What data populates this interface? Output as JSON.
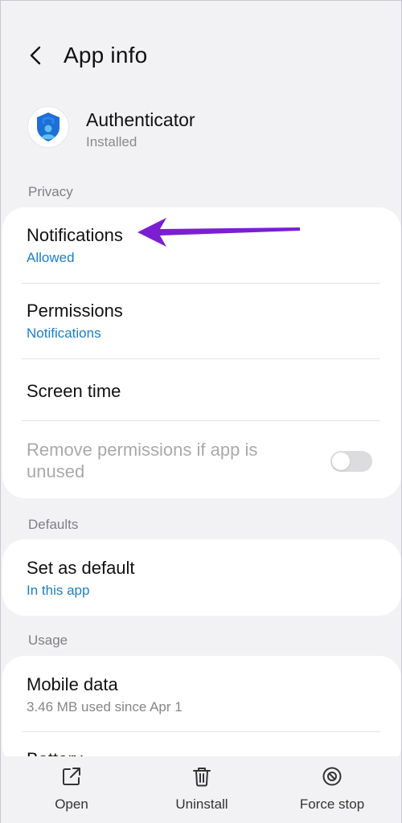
{
  "header": {
    "title": "App info",
    "back_icon": "chevron-left-icon"
  },
  "app": {
    "name": "Authenticator",
    "status": "Installed",
    "icon": "authenticator-lock-icon"
  },
  "privacy": {
    "section_label": "Privacy",
    "items": [
      {
        "title": "Notifications",
        "subtitle": "Allowed"
      },
      {
        "title": "Permissions",
        "subtitle": "Notifications"
      },
      {
        "title": "Screen time"
      },
      {
        "title": "Remove permissions if app is unused",
        "toggle_on": false
      }
    ]
  },
  "defaults": {
    "section_label": "Defaults",
    "items": [
      {
        "title": "Set as default",
        "subtitle": "In this app"
      }
    ]
  },
  "usage": {
    "section_label": "Usage",
    "items": [
      {
        "title": "Mobile data",
        "subtitle": "3.46 MB used since Apr 1"
      },
      {
        "title": "Battery"
      }
    ]
  },
  "bottom_bar": {
    "open_label": "Open",
    "uninstall_label": "Uninstall",
    "force_stop_label": "Force stop"
  },
  "colors": {
    "accent_blue": "#1a7fc9",
    "annotation_arrow": "#7a1fd1"
  }
}
